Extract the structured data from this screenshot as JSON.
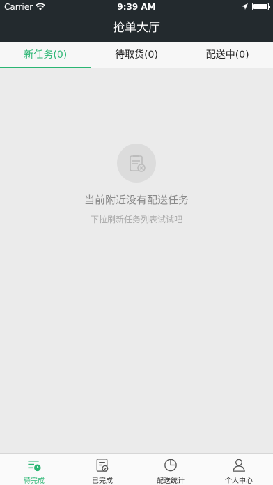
{
  "statusbar": {
    "carrier": "Carrier",
    "time": "9:39 AM"
  },
  "header": {
    "title": "抢单大厅"
  },
  "tabs": [
    {
      "label": "新任务(0)",
      "active": true
    },
    {
      "label": "待取货(0)",
      "active": false
    },
    {
      "label": "配送中(0)",
      "active": false
    }
  ],
  "empty_state": {
    "icon": "clipboard-x-icon",
    "title": "当前附近没有配送任务",
    "subtitle": "下拉刷新任务列表试试吧"
  },
  "tabbar": {
    "items": [
      {
        "label": "待完成",
        "icon": "pending-list-icon",
        "active": true
      },
      {
        "label": "已完成",
        "icon": "completed-check-icon",
        "active": false
      },
      {
        "label": "配送统计",
        "icon": "pie-chart-icon",
        "active": false
      },
      {
        "label": "个人中心",
        "icon": "person-icon",
        "active": false
      }
    ]
  },
  "colors": {
    "accent": "#2bb673",
    "navbar": "#232a2e",
    "background": "#ebebeb"
  }
}
